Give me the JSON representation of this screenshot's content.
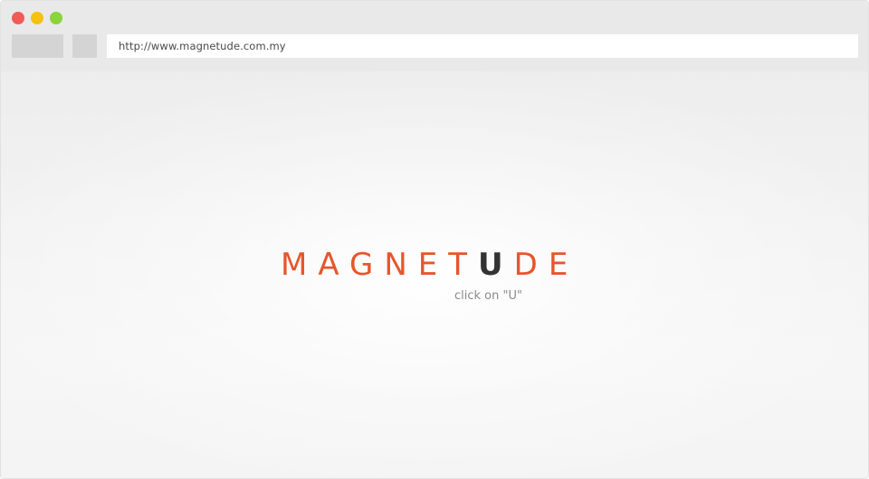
{
  "browser": {
    "url": "http://www.magnetude.com.my"
  },
  "logo": {
    "part1": "MAGNET",
    "highlight": "U",
    "part2": "DE"
  },
  "hint": {
    "text": "click on \"U\""
  },
  "colors": {
    "accent": "#e8552b",
    "highlight": "#333333",
    "traffic_close": "#f25a57",
    "traffic_minimize": "#f5c111",
    "traffic_maximize": "#8ad43c"
  }
}
